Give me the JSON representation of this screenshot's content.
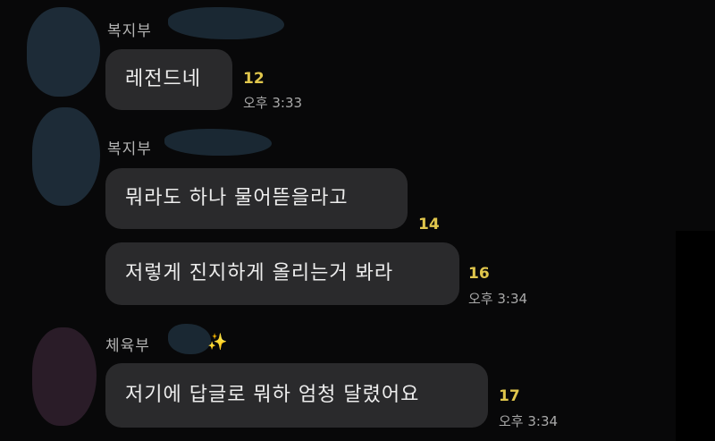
{
  "messages": [
    {
      "sender": "복지부",
      "bubbles": [
        {
          "text": "레전드네",
          "unread": "12",
          "time": "오후 3:33"
        }
      ]
    },
    {
      "sender": "복지부",
      "bubbles": [
        {
          "text": "뭐라도 하나 물어뜯을라고",
          "unread": "14",
          "time": ""
        },
        {
          "text": "저렇게 진지하게 올리는거 봐라",
          "unread": "16",
          "time": "오후 3:34"
        }
      ]
    },
    {
      "sender": "체육부",
      "sender_suffix": "✨",
      "bubbles": [
        {
          "text": "저기에 답글로 뭐하 엄청 달렸어요",
          "unread": "17",
          "time": "오후 3:34"
        }
      ]
    }
  ],
  "colors": {
    "background": "#080809",
    "bubble": "#2a2a2c",
    "unread": "#e0c64c",
    "redaction": "#1b2a36"
  }
}
